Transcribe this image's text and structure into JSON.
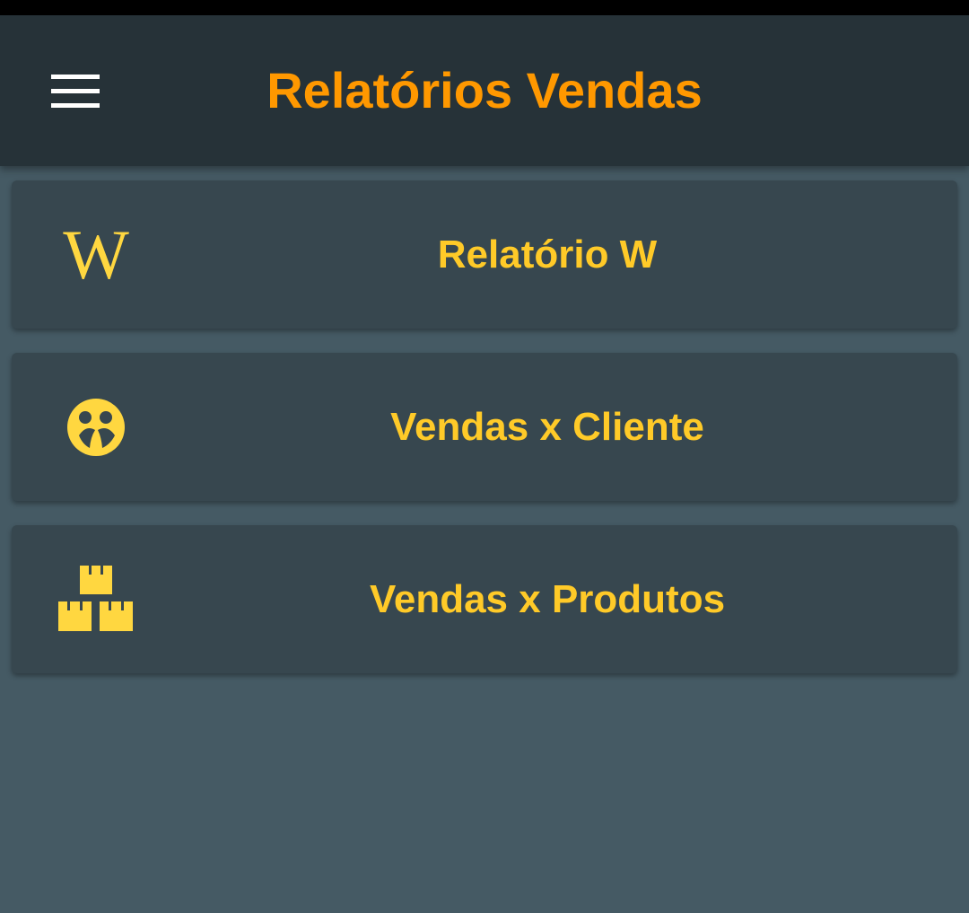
{
  "app_bar": {
    "title": "Relatórios Vendas",
    "menu_icon": "hamburger-menu-icon",
    "title_color": "#ff9800",
    "background": "#263238"
  },
  "menu": {
    "items": [
      {
        "label": "Relatório W",
        "icon": "wikipedia-w-icon",
        "glyph": "W"
      },
      {
        "label": "Vendas x Cliente",
        "icon": "emoticon-face-icon"
      },
      {
        "label": "Vendas x Produtos",
        "icon": "stacked-boxes-icon"
      }
    ],
    "label_color": "#ffca28",
    "card_background": "#37474f"
  },
  "page_background": "#455a64"
}
